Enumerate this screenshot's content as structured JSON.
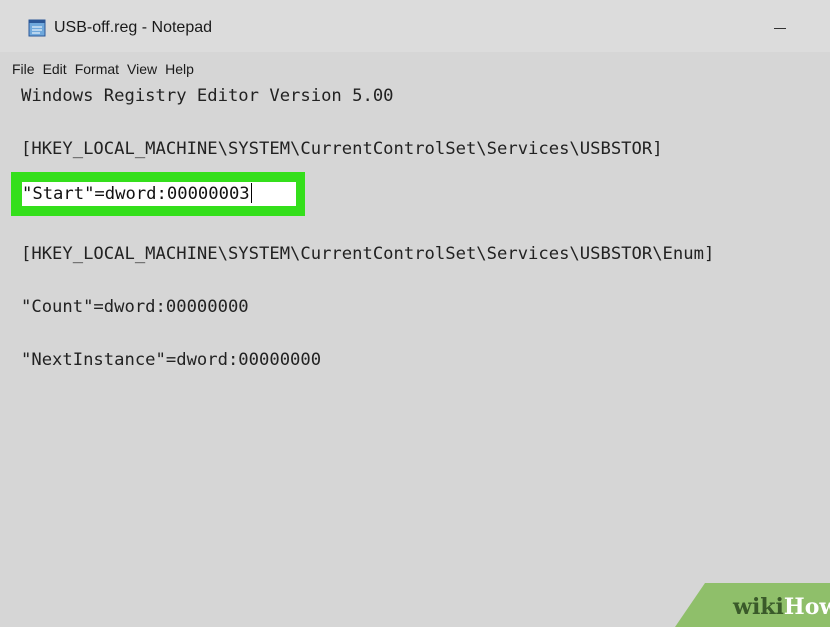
{
  "window": {
    "title": "USB-off.reg - Notepad"
  },
  "menu": {
    "items": [
      "File",
      "Edit",
      "Format",
      "View",
      "Help"
    ]
  },
  "editor": {
    "lines": [
      "Windows Registry Editor Version 5.00",
      "[HKEY_LOCAL_MACHINE\\SYSTEM\\CurrentControlSet\\Services\\USBSTOR]",
      "\"Start\"=dword:00000003",
      "[HKEY_LOCAL_MACHINE\\SYSTEM\\CurrentControlSet\\Services\\USBSTOR\\Enum]",
      "\"Count\"=dword:00000000",
      "\"NextInstance\"=dword:00000000"
    ],
    "highlighted_line_index": 2
  },
  "watermark": {
    "text": "wikiHow"
  },
  "colors": {
    "window_bg": "#d6d6d6",
    "highlight": "#34df1b",
    "watermark_green": "#8fbf6a"
  },
  "icons": {
    "app": "notepad-icon",
    "minimize": "minimize-icon"
  }
}
